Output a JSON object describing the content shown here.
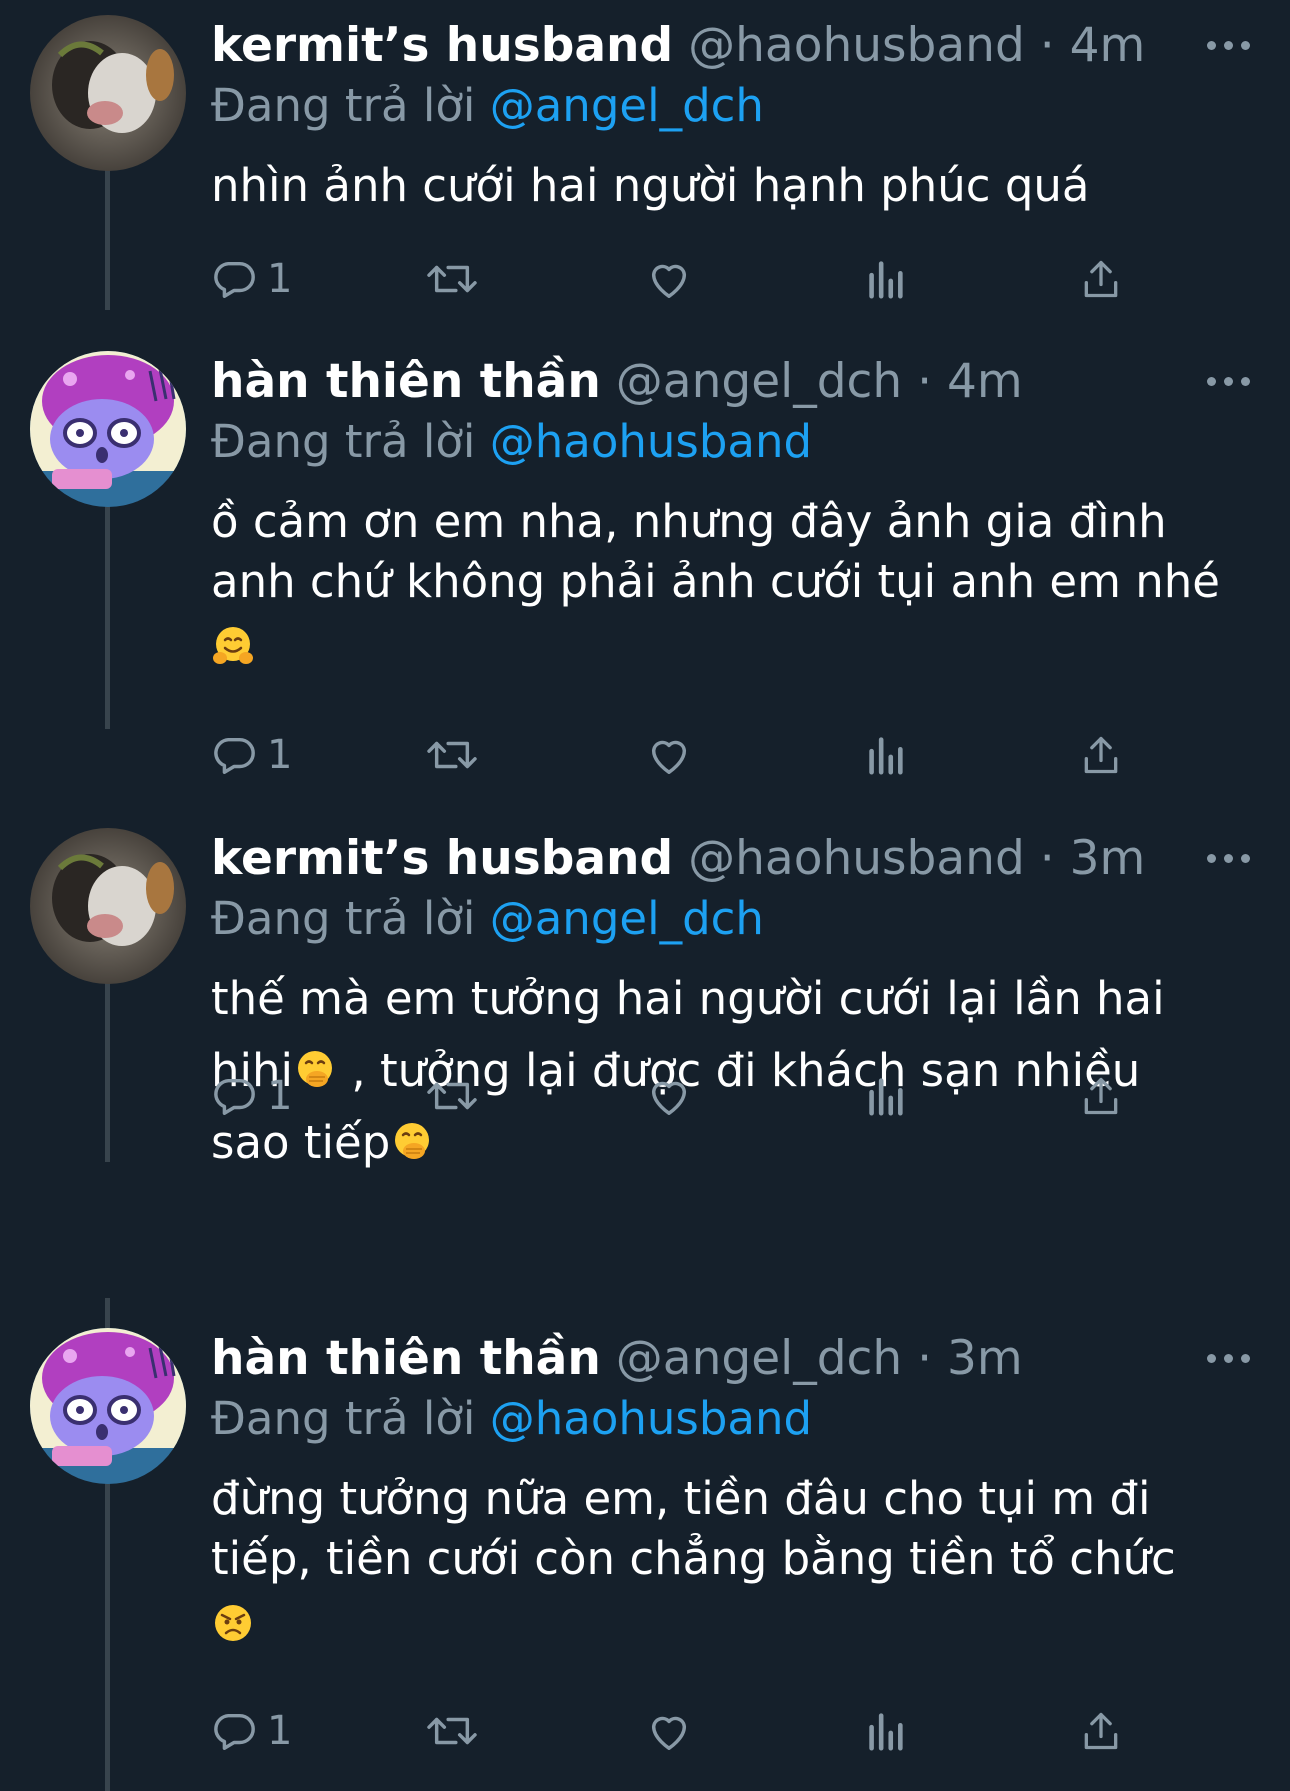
{
  "thread": [
    {
      "name": "kermit’s husband",
      "handle": "@haohusband",
      "separator": "·",
      "time": "4m",
      "reply_prefix": "Đang trả lời",
      "reply_to": "@angel_dch",
      "text_lines": [
        "nhìn ảnh cưới hai người hạnh phúc quá"
      ],
      "emoji": "",
      "reply_count": "1",
      "avatar": "cat-photo-avatar"
    },
    {
      "name": "hàn thiên thần",
      "handle": "@angel_dch",
      "separator": "·",
      "time": "4m",
      "reply_prefix": "Đang trả lời",
      "reply_to": "@haohusband",
      "text_lines": [
        "ồ cảm ơn em nha, nhưng đây ảnh gia đình",
        "anh chứ không phải ảnh cưới tụi anh em nhé"
      ],
      "emoji": "🤗",
      "reply_count": "1",
      "avatar": "purple-cartoon-avatar"
    },
    {
      "name": "kermit’s husband",
      "handle": "@haohusband",
      "separator": "·",
      "time": "3m",
      "reply_prefix": "Đang trả lời",
      "reply_to": "@angel_dch",
      "text_lines": [
        "thế mà em tưởng hai người cưới lại lần hai",
        "hihi",
        " , tưởng lại được đi khách sạn nhiều",
        "sao tiếp"
      ],
      "emoji": "🤭",
      "reply_count": "1",
      "avatar": "cat-photo-avatar"
    },
    {
      "name": "hàn thiên thần",
      "handle": "@angel_dch",
      "separator": "·",
      "time": "3m",
      "reply_prefix": "Đang trả lời",
      "reply_to": "@haohusband",
      "text_lines": [
        "đừng tưởng nữa em, tiền đâu cho tụi m đi",
        "tiếp, tiền cưới còn chẳng bằng tiền tổ chức"
      ],
      "emoji": "😠",
      "reply_count": "1",
      "avatar": "purple-cartoon-avatar"
    }
  ],
  "actions": {
    "icons": [
      "reply-icon",
      "retweet-icon",
      "like-icon",
      "analytics-icon",
      "share-icon"
    ]
  },
  "colors": {
    "background": "#15202b",
    "text": "#ffffff",
    "muted": "#8899a6",
    "link": "#1da1f2",
    "thread_line": "#38444d"
  }
}
